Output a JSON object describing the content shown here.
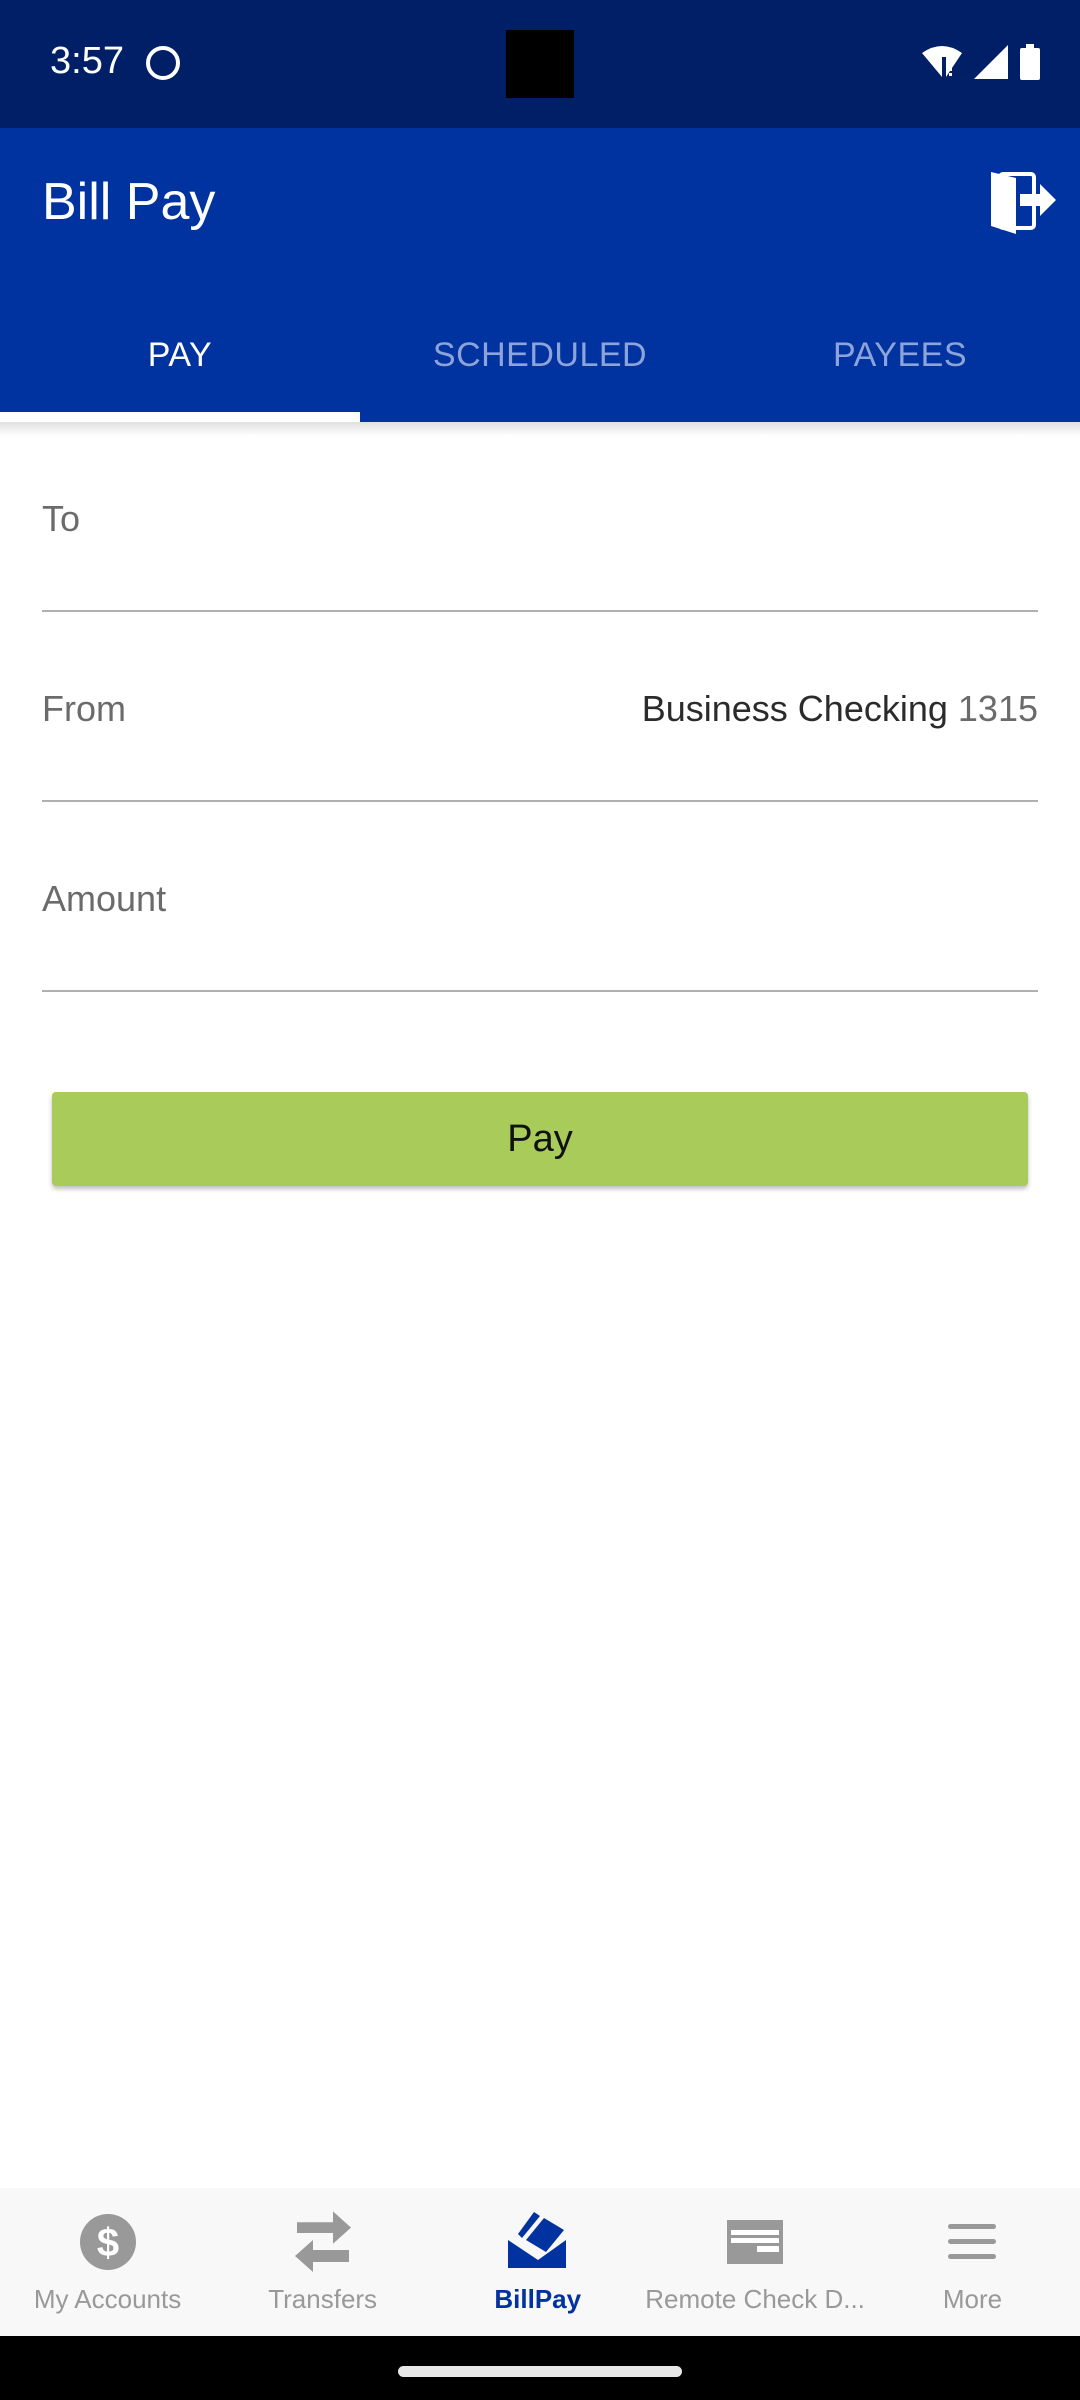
{
  "status_bar": {
    "time": "3:57",
    "icons": [
      "cat-notification-icon",
      "wifi-alert-icon",
      "signal-icon",
      "battery-icon"
    ]
  },
  "app_bar": {
    "title": "Bill Pay",
    "logout_icon": "logout-door-icon"
  },
  "tabs": [
    {
      "label": "PAY",
      "active": true
    },
    {
      "label": "SCHEDULED",
      "active": false
    },
    {
      "label": "PAYEES",
      "active": false
    }
  ],
  "form": {
    "to": {
      "label": "To",
      "value": ""
    },
    "from": {
      "label": "From",
      "account_name": "Business Checking",
      "account_number": "1315"
    },
    "amount": {
      "label": "Amount",
      "value": ""
    }
  },
  "pay_button": {
    "label": "Pay"
  },
  "bottom_nav": [
    {
      "label": "My Accounts",
      "icon": "dollar-circle-icon",
      "active": false
    },
    {
      "label": "Transfers",
      "icon": "transfer-arrows-icon",
      "active": false
    },
    {
      "label": "BillPay",
      "icon": "bill-envelope-icon",
      "active": true
    },
    {
      "label": "Remote Check D...",
      "icon": "check-deposit-icon",
      "active": false
    },
    {
      "label": "More",
      "icon": "menu-icon",
      "active": false
    }
  ],
  "colors": {
    "status_bar": "#001f66",
    "brand_blue": "#0033a0",
    "pay_button": "#a8cb5a",
    "inactive_tab": "#8da4da",
    "inactive_nav": "#999999"
  }
}
